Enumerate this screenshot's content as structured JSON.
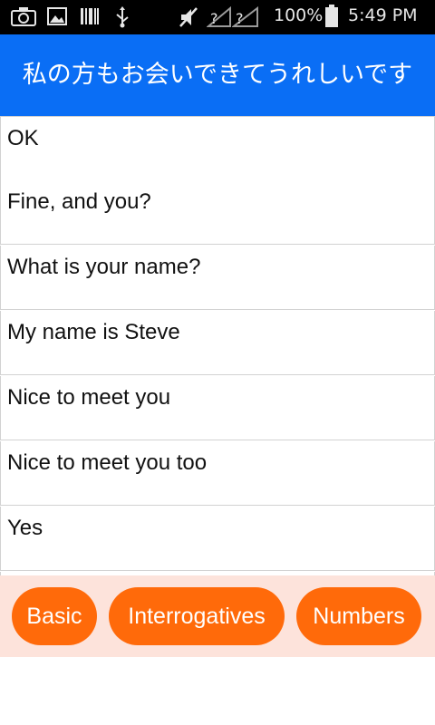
{
  "status_bar": {
    "battery_percent": "100%",
    "time": "5:49 PM",
    "icons": [
      "camera-icon",
      "image-icon",
      "barcode-icon",
      "usb-icon",
      "mute-icon",
      "no-signal-icon",
      "no-signal-icon",
      "battery-icon"
    ]
  },
  "header": {
    "title": "私の方もお会いできてうれしいです",
    "background_color": "#0a6ef5"
  },
  "phrases": [
    {
      "label": "OK"
    },
    {
      "label": "Fine, and you?"
    },
    {
      "label": "What is your name?"
    },
    {
      "label": "My name is Steve"
    },
    {
      "label": "Nice to meet you"
    },
    {
      "label": "Nice to meet you too"
    },
    {
      "label": "Yes"
    }
  ],
  "categories": [
    {
      "label": "Basic"
    },
    {
      "label": "Interrogatives"
    },
    {
      "label": "Numbers"
    }
  ],
  "colors": {
    "accent": "#ff6a0a",
    "bottom_bar": "#fde3db"
  }
}
